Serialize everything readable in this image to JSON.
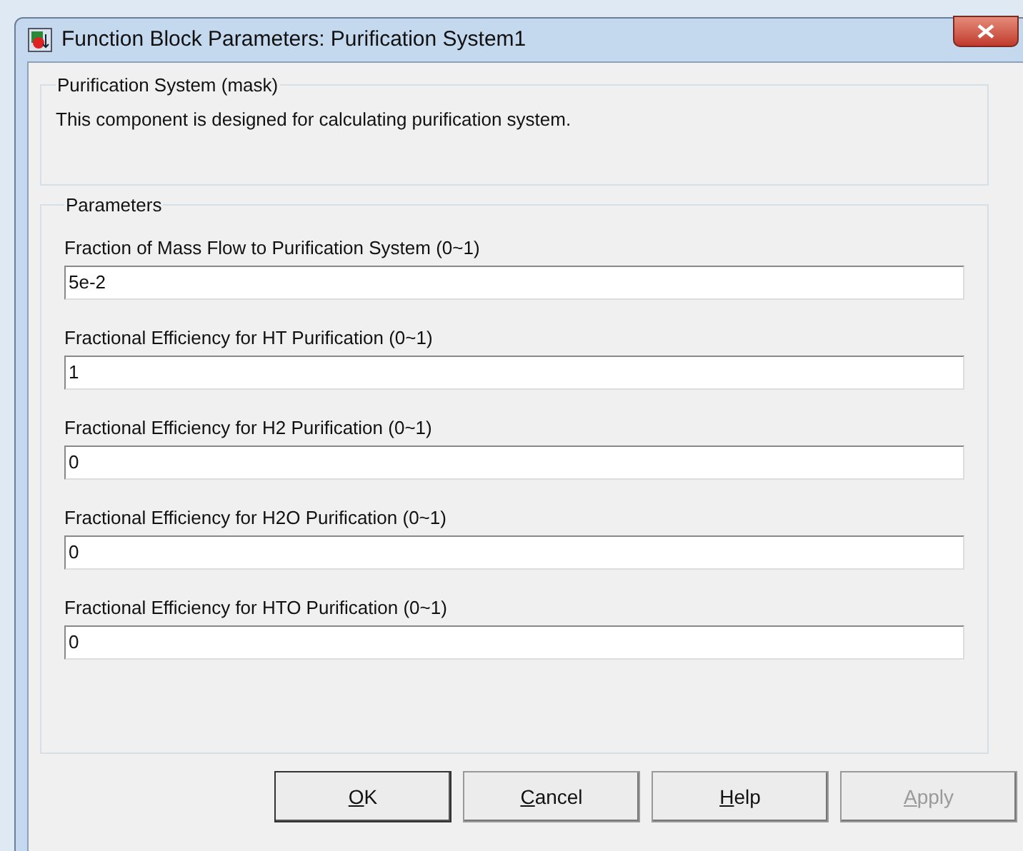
{
  "window": {
    "title": "Function Block Parameters: Purification System1"
  },
  "description_group": {
    "title": "Purification System (mask)",
    "text": "This component is designed for calculating purification system."
  },
  "parameters_group": {
    "title": "Parameters",
    "fields": [
      {
        "label": "Fraction of Mass Flow to Purification System (0~1)",
        "value": "5e-2"
      },
      {
        "label": "Fractional Efficiency for HT Purification (0~1)",
        "value": "1"
      },
      {
        "label": "Fractional Efficiency for H2 Purification (0~1)",
        "value": "0"
      },
      {
        "label": "Fractional Efficiency for H2O Purification (0~1)",
        "value": "0"
      },
      {
        "label": "Fractional Efficiency for HTO Purification (0~1)",
        "value": "0"
      }
    ]
  },
  "buttons": [
    {
      "label": "OK",
      "underline_first": true,
      "disabled": false,
      "focused": true
    },
    {
      "label": "Cancel",
      "underline_first": true,
      "disabled": false,
      "focused": false
    },
    {
      "label": "Help",
      "underline_first": true,
      "disabled": false,
      "focused": false
    },
    {
      "label": "Apply",
      "underline_first": true,
      "disabled": true,
      "focused": false
    }
  ]
}
